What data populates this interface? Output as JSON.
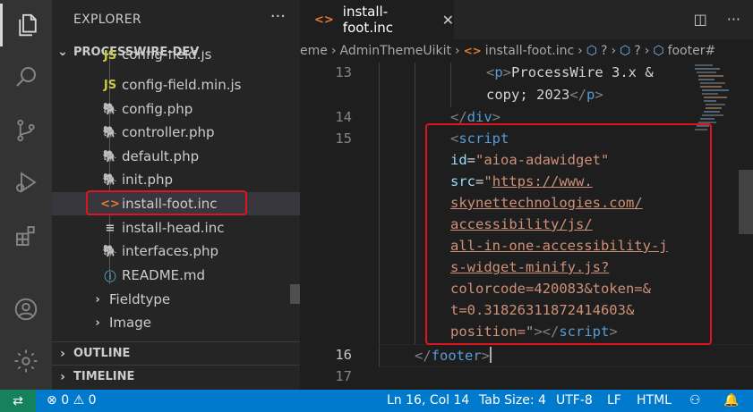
{
  "activity_bar": {
    "items": [
      "explorer-icon",
      "search-icon",
      "source-control-icon",
      "run-debug-icon",
      "extensions-icon"
    ],
    "bottom": [
      "account-icon",
      "settings-gear-icon"
    ]
  },
  "sidebar": {
    "title": "EXPLORER",
    "more": "···",
    "root": "PROCESSWIRE-DEV",
    "files": [
      {
        "icon": "JS",
        "name": "config-field.js",
        "color": "#cbcb41"
      },
      {
        "icon": "JS",
        "name": "config-field.min.js",
        "color": "#cbcb41"
      },
      {
        "icon": "php",
        "name": "config.php",
        "color": "#a074c4"
      },
      {
        "icon": "php",
        "name": "controller.php",
        "color": "#a074c4"
      },
      {
        "icon": "php",
        "name": "default.php",
        "color": "#a074c4"
      },
      {
        "icon": "php",
        "name": "init.php",
        "color": "#a074c4"
      },
      {
        "icon": "<>",
        "name": "install-foot.inc",
        "color": "#e37933"
      },
      {
        "icon": "≡",
        "name": "install-head.inc",
        "color": "#cccccc"
      },
      {
        "icon": "php",
        "name": "interfaces.php",
        "color": "#a074c4"
      },
      {
        "icon": "ⓘ",
        "name": "README.md",
        "color": "#519aba"
      }
    ],
    "folders": [
      "Fieldtype",
      "Image"
    ],
    "sections": [
      "OUTLINE",
      "TIMELINE"
    ]
  },
  "tab": {
    "icon": "<>",
    "label": "install-foot.inc",
    "close": "✕"
  },
  "breadcrumb": [
    "eme",
    "AdminThemeUikit",
    "install-foot.inc",
    "?",
    "?",
    "footer#"
  ],
  "editor": {
    "line_numbers": [
      "13",
      "14",
      "15",
      "16",
      "17"
    ],
    "lines": {
      "l13a_open": "<",
      "l13a_tag": "p",
      "l13a_close": ">",
      "l13a_text": "ProcessWire 3.x &",
      "l13b_text": "copy; 2023",
      "l13b_open": "</",
      "l13b_tag": "p",
      "l13b_close": ">",
      "l14_open": "</",
      "l14_tag": "div",
      "l14_close": ">",
      "l15_open": "<",
      "l15_tag": "script",
      "l15_id_attr": "id",
      "l15_id_eq": "=",
      "l15_id_val": "\"aioa-adawidget\"",
      "l15_src_attr": "src",
      "l15_src_eq": "=",
      "l15_q1": "\"",
      "url1": "https://www.",
      "url2": "skynettechnologies.com/",
      "url3": "accessibility/js/",
      "url4": "all-in-one-accessibility-j",
      "url5": "s-widget-minify.js?",
      "p1": "colorcode=420083&token=&",
      "p2": "t=0.31826311872414603&",
      "p3": "position=",
      "q2": "\"",
      "cl1": "></",
      "cl_tag": "script",
      "cl2": ">",
      "l16_open": "</",
      "l16_tag": "footer",
      "l16_close": ">"
    }
  },
  "status": {
    "errors": "0",
    "warnings": "0",
    "position": "Ln 16, Col 14",
    "tab_size": "Tab Size: 4",
    "encoding": "UTF-8",
    "eol": "LF",
    "language": "HTML"
  }
}
